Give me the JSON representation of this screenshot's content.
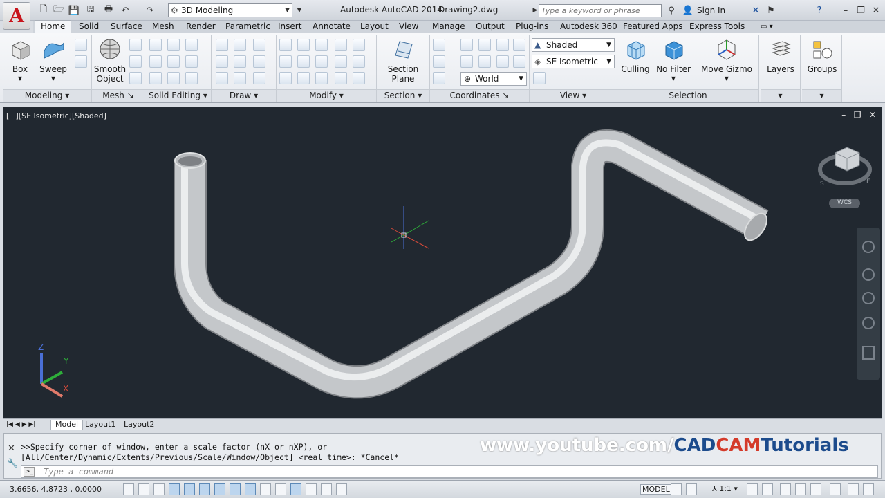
{
  "titlebar": {
    "workspace": "3D Modeling",
    "app_title": "Autodesk AutoCAD 2014",
    "doc_title": "Drawing2.dwg",
    "search_placeholder": "Type a keyword or phrase",
    "signin": "Sign In"
  },
  "tabs": [
    "Home",
    "Solid",
    "Surface",
    "Mesh",
    "Render",
    "Parametric",
    "Insert",
    "Annotate",
    "Layout",
    "View",
    "Manage",
    "Output",
    "Plug-ins",
    "Autodesk 360",
    "Featured Apps",
    "Express Tools"
  ],
  "ribbon": {
    "box": "Box",
    "sweep": "Sweep",
    "smooth_object": "Smooth\nObject",
    "section_plane": "Section\nPlane",
    "visual_style": "Shaded",
    "view_preset": "SE Isometric",
    "ucs": "World",
    "culling": "Culling",
    "no_filter": "No Filter",
    "move_gizmo": "Move Gizmo",
    "layers": "Layers",
    "groups": "Groups",
    "panels": {
      "modeling": "Modeling",
      "mesh": "Mesh",
      "solid_editing": "Solid Editing",
      "draw": "Draw",
      "modify": "Modify",
      "section": "Section",
      "coordinates": "Coordinates",
      "view": "View",
      "selection": "Selection"
    }
  },
  "viewport": {
    "label": "[−][SE Isometric][Shaded]",
    "wcs": "WCS",
    "axis_x": "X",
    "axis_y": "Y",
    "axis_z": "Z",
    "bg": "#212830",
    "pipe_color": "#c4c7ca"
  },
  "layout_tabs": [
    "Model",
    "Layout1",
    "Layout2"
  ],
  "command": {
    "history_line1": ">>Specify corner of window, enter a scale factor (nX or nXP), or",
    "history_line2": "[All/Center/Dynamic/Extents/Previous/Scale/Window/Object] <real time>: *Cancel*",
    "placeholder": "Type a command"
  },
  "watermark": {
    "prefix": "www.youtube.com/",
    "brand1": "CAD",
    "brand2": "CAM",
    "brand3": "Tutorials"
  },
  "statusbar": {
    "coords": "3.6656, 4.8723 , 0.0000",
    "model": "MODEL",
    "scale": "1:1"
  }
}
